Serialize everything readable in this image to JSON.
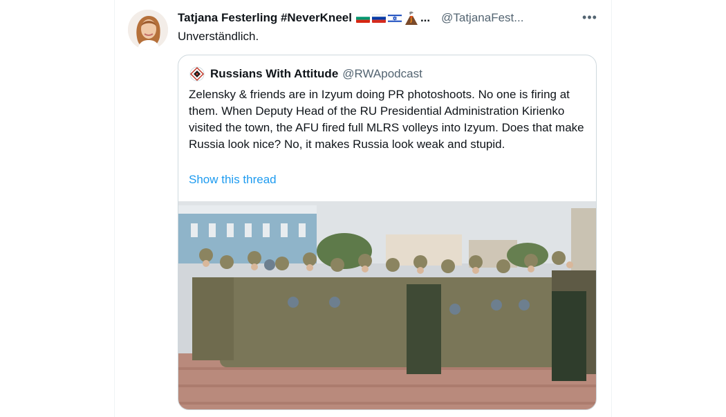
{
  "tweet": {
    "display_name": "Tatjana Festerling #NeverKneel",
    "name_ellipsis": "...",
    "handle": "@TatjanaFest...",
    "text": "Unverständlich.",
    "more_label": "•••"
  },
  "quoted": {
    "display_name": "Russians With Attitude",
    "handle": "@RWApodcast",
    "text": "Zelensky & friends are in Izyum doing PR photoshoots. No one is firing at them. When Deputy Head of the RU Presidential Administration Kirienko visited the town, the AFU fired full MLRS volleys into Izyum. Does that make Russia look nice? No, it makes Russia look weak and stupid.",
    "show_thread": "Show this thread"
  },
  "icons": {
    "flags": [
      "bulgaria-flag-icon",
      "russia-flag-icon",
      "israel-flag-icon",
      "volcano-icon"
    ],
    "more": "more-options-icon",
    "quoted_avatar": "rwa-logo-icon"
  },
  "colors": {
    "link": "#1d9bf0",
    "secondary_text": "#536471",
    "border": "#cfd9de"
  }
}
